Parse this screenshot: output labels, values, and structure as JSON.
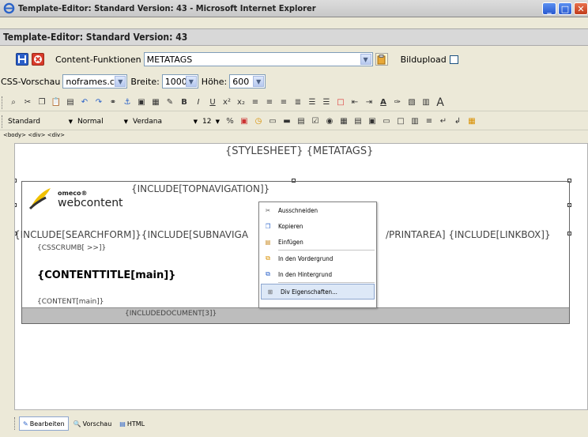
{
  "window": {
    "title": "Template-Editor: Standard Version: 43 - Microsoft Internet Explorer"
  },
  "header": {
    "title": "Template-Editor: Standard Version: 43"
  },
  "row1": {
    "content_functions_label": "Content-Funktionen",
    "content_functions_value": "METATAGS",
    "bildupload_label": "Bildupload"
  },
  "row2": {
    "css_preview_label": "CSS-Vorschau",
    "css_value": "noframes.css",
    "width_label": "Breite:",
    "width_value": "1000",
    "height_label": "Höhe:",
    "height_value": "600"
  },
  "format_toolbar": {
    "style_value": "Standard",
    "format_value": "Normal",
    "font_value": "Verdana",
    "size_value": "12"
  },
  "path": "<body> <div> <div>",
  "canvas": {
    "stylesheet": "{STYLESHEET} {METATAGS}",
    "topnav": "{INCLUDE[TOPNAVIGATION]}",
    "searchform": "{INCLUDE[SEARCHFORM]}{INCLUDE[SUBNAVIGA",
    "printarea": "/PRINTAREA] {INCLUDE[LINKBOX]}",
    "cssbreadcrumb": "{CSSCRUMB[ >>]}",
    "contenttitle": "{CONTENTTITLE[main]}",
    "content": "{CONTENT[main]}",
    "includedocument": "{INCLUDEDOCUMENT[3]}",
    "logo_brand_small": "omeco®",
    "logo_brand_large": "webcontent"
  },
  "context_menu": {
    "items": [
      "Ausschneiden",
      "Kopieren",
      "Einfügen",
      "In den Vordergrund",
      "In den Hintergrund",
      "Div Eigenschaften..."
    ]
  },
  "bottom_tabs": [
    "Bearbeiten",
    "Vorschau",
    "HTML"
  ],
  "colors": {
    "accent": "#316ac5",
    "menu_highlight": "#dde8f7"
  }
}
